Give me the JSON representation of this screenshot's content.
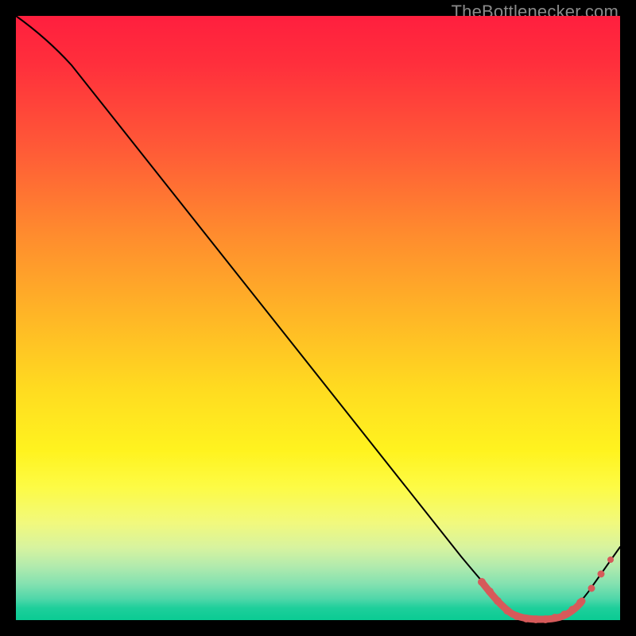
{
  "watermark": "TheBottlenecker.com",
  "colors": {
    "background": "#000000",
    "gradient_top": "#ff1f3e",
    "gradient_bottom": "#0acb93",
    "line": "#000000",
    "accent": "#d65a5a"
  },
  "chart_data": {
    "type": "line",
    "title": "",
    "xlabel": "",
    "ylabel": "",
    "xlim": [
      0,
      100
    ],
    "ylim": [
      0,
      100
    ],
    "grid": false,
    "legend": false,
    "x": [
      0,
      5,
      10,
      15,
      20,
      25,
      30,
      35,
      40,
      45,
      50,
      55,
      60,
      65,
      70,
      75,
      78,
      80,
      82,
      84,
      86,
      88,
      90,
      92,
      94,
      96,
      100
    ],
    "y": [
      100,
      97,
      93,
      88,
      82,
      76,
      70,
      64,
      58,
      52,
      46,
      40,
      33,
      27,
      20,
      12,
      7,
      4,
      2,
      1,
      0.5,
      0.3,
      0.3,
      0.5,
      1.5,
      3,
      9
    ],
    "highlight_segment": {
      "x_start": 78,
      "x_end": 96,
      "note": "pink marker run along curve near minimum"
    },
    "extra_markers_x": [
      94,
      96,
      98
    ]
  }
}
